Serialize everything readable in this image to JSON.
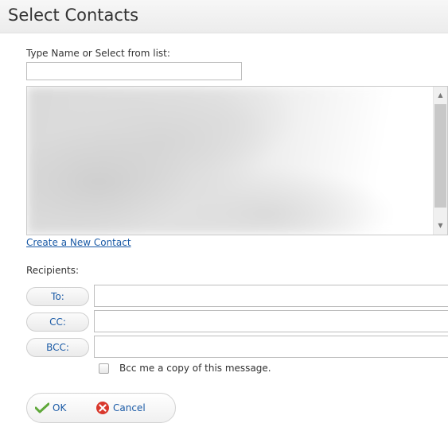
{
  "dialog": {
    "title": "Select Contacts"
  },
  "search": {
    "label": "Type Name or Select from list:",
    "value": "",
    "placeholder": ""
  },
  "contact_list": {
    "items": []
  },
  "create_contact_link": "Create a New Contact",
  "recipients": {
    "label": "Recipients:",
    "to_label": "To:",
    "cc_label": "CC:",
    "bcc_label": "BCC:",
    "to_value": "",
    "cc_value": "",
    "bcc_value": ""
  },
  "bcc_me": {
    "label": "Bcc me a copy of this message.",
    "checked": false
  },
  "buttons": {
    "ok_label": "OK",
    "cancel_label": "Cancel"
  },
  "icons": {
    "ok": "checkmark-icon",
    "cancel": "cancel-x-icon",
    "scroll_up": "scroll-up-arrow-icon",
    "scroll_down": "scroll-down-arrow-icon"
  },
  "colors": {
    "link": "#1a5aa6",
    "ok_check": "#5fa83a",
    "cancel_icon": "#d9382c"
  }
}
